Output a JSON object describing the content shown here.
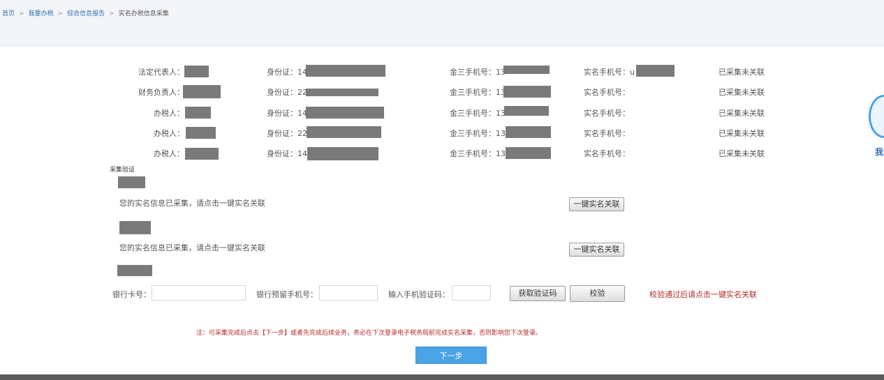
{
  "breadcrumb": {
    "items": [
      "首页",
      "我要办税",
      "综合信息报告"
    ],
    "current": "实名办税信息采集",
    "separator": ">"
  },
  "people": [
    {
      "role": "法定代表人：",
      "id_label": "身份证：",
      "id_prefix": "14",
      "phone3_label": "金三手机号：",
      "phone3_prefix": "13",
      "realname_label": "实名手机号：",
      "realname_prefix": "u",
      "status": "已采集未关联"
    },
    {
      "role": "财务负责人：",
      "id_label": "身份证：",
      "id_prefix": "22",
      "phone3_label": "金三手机号：",
      "phone3_prefix": "13",
      "realname_label": "实名手机号：",
      "realname_prefix": "",
      "status": "已采集未关联"
    },
    {
      "role": "办税人：",
      "id_label": "身份证：",
      "id_prefix": "14",
      "phone3_label": "金三手机号：",
      "phone3_prefix": "13",
      "realname_label": "实名手机号：",
      "realname_prefix": "",
      "status": "已采集未关联"
    },
    {
      "role": "办税人：",
      "id_label": "身份证：",
      "id_prefix": "22",
      "phone3_label": "金三手机号：",
      "phone3_prefix": "13",
      "realname_label": "实名手机号：",
      "realname_prefix": "",
      "status": "已采集未关联"
    },
    {
      "role": "办税人：",
      "id_label": "身份证：",
      "id_prefix": "14",
      "phone3_label": "金三手机号：",
      "phone3_prefix": "13",
      "realname_label": "实名手机号：",
      "realname_prefix": "",
      "status": "已采集未关联"
    }
  ],
  "verify": {
    "section_label": "采集验证",
    "blocks": [
      {
        "message": "您的实名信息已采集，请点击一键实名关联",
        "button": "一键实名关联"
      },
      {
        "message": "您的实名信息已采集，请点击一键实名关联",
        "button": "一键实名关联"
      }
    ],
    "bank_card_label": "银行卡号：",
    "bank_card_value": "",
    "bank_phone_label": "银行预留手机号：",
    "bank_phone_value": "",
    "sms_code_label": "输入手机验证码：",
    "sms_code_value": "",
    "get_code_button": "获取验证码",
    "check_button": "校验",
    "hint": "校验通过后请点击一键实名关联"
  },
  "note": "注：可采集完成后点击【下一步】或者先完成后续业务，务必在下次登录电子税务局前完成实名采集，否则影响您下次登录。",
  "next_button": "下一步",
  "side_float": {
    "text": "我",
    "icon": "service-icon"
  },
  "colors": {
    "accent": "#4aa3e5",
    "link": "#2f73b6",
    "warning": "#b32a2a",
    "mask": "#7a7a7a"
  }
}
